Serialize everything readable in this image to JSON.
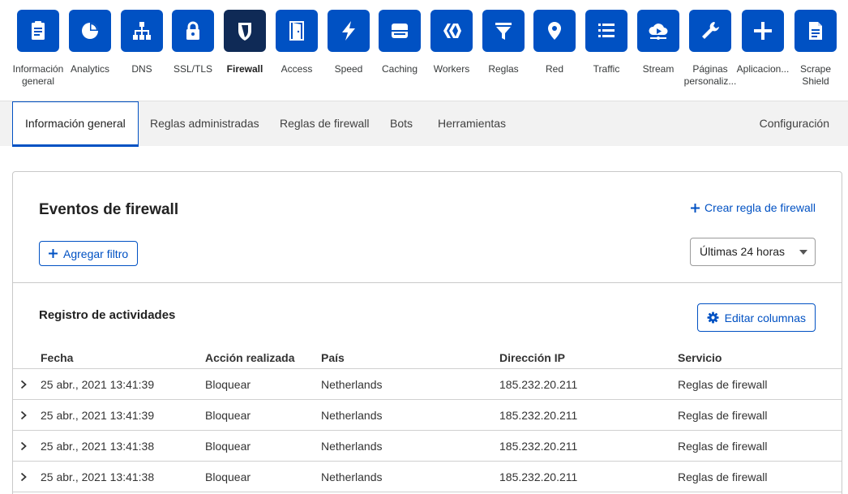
{
  "colors": {
    "accent": "#0051c3",
    "active_tile": "#0f2a56"
  },
  "app_nav": [
    {
      "label": "Información general",
      "icon": "clipboard-icon"
    },
    {
      "label": "Analytics",
      "icon": "pie-chart-icon"
    },
    {
      "label": "DNS",
      "icon": "network-icon"
    },
    {
      "label": "SSL/TLS",
      "icon": "lock-icon"
    },
    {
      "label": "Firewall",
      "icon": "shield-icon"
    },
    {
      "label": "Access",
      "icon": "door-icon"
    },
    {
      "label": "Speed",
      "icon": "lightning-icon"
    },
    {
      "label": "Caching",
      "icon": "server-icon"
    },
    {
      "label": "Workers",
      "icon": "workers-icon"
    },
    {
      "label": "Reglas",
      "icon": "filter-icon"
    },
    {
      "label": "Red",
      "icon": "location-pin-icon"
    },
    {
      "label": "Traffic",
      "icon": "list-icon"
    },
    {
      "label": "Stream",
      "icon": "cloud-play-icon"
    },
    {
      "label": "Páginas personaliz...",
      "icon": "wrench-icon"
    },
    {
      "label": "Aplicacion...",
      "icon": "plus-icon"
    },
    {
      "label": "Scrape Shield",
      "icon": "document-icon"
    }
  ],
  "sub_tabs": {
    "overview": "Información general",
    "managed_rules": "Reglas administradas",
    "firewall_rules": "Reglas de firewall",
    "bots": "Bots",
    "tools": "Herramientas",
    "settings": "Configuración"
  },
  "events": {
    "title": "Eventos de firewall",
    "create_rule": "Crear regla de firewall",
    "add_filter": "Agregar filtro",
    "time_range": "Últimas 24 horas"
  },
  "log": {
    "title": "Registro de actividades",
    "edit_columns": "Editar columnas",
    "columns": {
      "date": "Fecha",
      "action": "Acción realizada",
      "country": "País",
      "ip": "Dirección IP",
      "service": "Servicio"
    },
    "rows": [
      {
        "date": "25 abr., 2021 13:41:39",
        "action": "Bloquear",
        "country": "Netherlands",
        "ip": "185.232.20.211",
        "service": "Reglas de firewall"
      },
      {
        "date": "25 abr., 2021 13:41:39",
        "action": "Bloquear",
        "country": "Netherlands",
        "ip": "185.232.20.211",
        "service": "Reglas de firewall"
      },
      {
        "date": "25 abr., 2021 13:41:38",
        "action": "Bloquear",
        "country": "Netherlands",
        "ip": "185.232.20.211",
        "service": "Reglas de firewall"
      },
      {
        "date": "25 abr., 2021 13:41:38",
        "action": "Bloquear",
        "country": "Netherlands",
        "ip": "185.232.20.211",
        "service": "Reglas de firewall"
      }
    ]
  }
}
